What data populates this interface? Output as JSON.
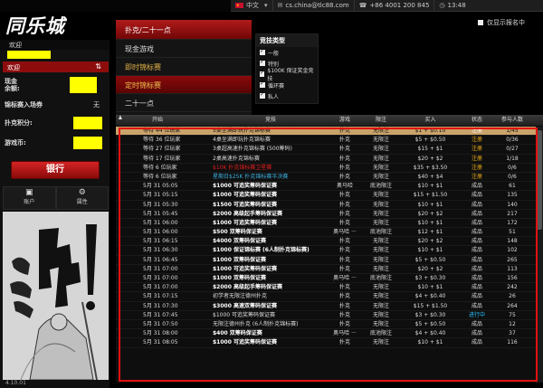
{
  "app": {
    "title": "同乐城"
  },
  "status_bar": {
    "language": "中文",
    "email": "cs.china@tlc88.com",
    "phone": "+86 4001 200 845",
    "time": "13:48"
  },
  "left": {
    "welcome_label": "欢迎",
    "welcome_bar": "欢迎",
    "cash_label": "现金\n余额:",
    "ticket_label": "锦标赛入场券",
    "ticket_value": "无",
    "points_label": "扑克积分:",
    "coins_label": "游戏币:",
    "bank_button": "银行",
    "tile_account": "账户",
    "tile_settings": "属性",
    "version": "4.10.01"
  },
  "menu": {
    "head": "扑克/二十一点",
    "items": [
      "现金游戏",
      "即时锦标赛",
      "定时锦标赛",
      "二十一点"
    ]
  },
  "filter": {
    "title": "竞技类型",
    "options": [
      {
        "label": "一般",
        "checked": true
      },
      {
        "label": "特别",
        "checked": true
      },
      {
        "label": "$100K 保证奖金竞技",
        "checked": true
      },
      {
        "label": "循环赛",
        "checked": true
      },
      {
        "label": "私人",
        "checked": true
      }
    ],
    "only_signup": "仅显示报名中"
  },
  "table": {
    "headers": [
      "",
      "开始",
      "竞技",
      "游戏",
      "限注",
      "买入",
      "状态",
      "参与人数"
    ],
    "rows": [
      {
        "start": "等待 44 位玩家",
        "name": "5桌坐满即玩扑克锦标赛",
        "game": "扑克",
        "limit": "无限注",
        "buyin": "$1 + $0.10",
        "status": "注册",
        "players": "1/45",
        "style": "hl"
      },
      {
        "start": "等待 36 位玩家",
        "name": "4桌坐满即玩扑克锦标赛",
        "game": "扑克",
        "limit": "无限注",
        "buyin": "$5 + $0.50",
        "status": "注册",
        "players": "0/36",
        "style": "signup"
      },
      {
        "start": "等待 27 位玩家",
        "name": "3桌超高速扑克锦标赛 (500筹码)",
        "game": "扑克",
        "limit": "无限注",
        "buyin": "$15 + $1",
        "status": "注册",
        "players": "0/27",
        "style": "signup"
      },
      {
        "start": "等待 17 位玩家",
        "name": "2桌高速扑克锦标赛",
        "game": "扑克",
        "limit": "无限注",
        "buyin": "$20 + $2",
        "status": "注册",
        "players": "1/18",
        "style": "signup"
      },
      {
        "start": "等待 6 位玩家",
        "name": "$10K 扑克锦标赛卫星赛",
        "game": "扑克",
        "limit": "无限注",
        "buyin": "$35 + $3.50",
        "status": "注册",
        "players": "0/6",
        "style": "red"
      },
      {
        "start": "等待 6 位玩家",
        "name": "星期日$25K 扑克锦标赛半决赛",
        "game": "扑克",
        "limit": "无限注",
        "buyin": "$40 + $4",
        "status": "注册",
        "players": "0/6",
        "style": "cyan"
      },
      {
        "start": "5月 31 05:05",
        "name": "$1000 可追奖筹码保证赛",
        "game": "奥马哈",
        "limit": "底池限注",
        "buyin": "$10 + $1",
        "status": "成品",
        "players": "61",
        "style": "bold"
      },
      {
        "start": "5月 31 05:15",
        "name": "$1000 可追奖筹码保证赛",
        "game": "扑克",
        "limit": "无限注",
        "buyin": "$15 + $1.50",
        "status": "成品",
        "players": "135",
        "style": "bold"
      },
      {
        "start": "5月 31 05:30",
        "name": "$1500 可追奖筹码保证赛",
        "game": "扑克",
        "limit": "无限注",
        "buyin": "$10 + $1",
        "status": "成品",
        "players": "140",
        "style": "bold"
      },
      {
        "start": "5月 31 05:45",
        "name": "$2000 高级起手筹码保证赛",
        "game": "扑克",
        "limit": "无限注",
        "buyin": "$20 + $2",
        "status": "成品",
        "players": "217",
        "style": "bold"
      },
      {
        "start": "5月 31 06:00",
        "name": "$1000 可追奖筹码保证赛",
        "game": "扑克",
        "limit": "无限注",
        "buyin": "$10 + $1",
        "status": "成品",
        "players": "172",
        "style": "bold"
      },
      {
        "start": "5月 31 06:00",
        "name": "$500 双筹码保证赛",
        "game": "奥马哈 ···",
        "limit": "底池限注",
        "buyin": "$12 + $1",
        "status": "成品",
        "players": "51",
        "style": "bold"
      },
      {
        "start": "5月 31 06:15",
        "name": "$4000 双筹码保证赛",
        "game": "扑克",
        "limit": "无限注",
        "buyin": "$20 + $2",
        "status": "成品",
        "players": "148",
        "style": "bold"
      },
      {
        "start": "5月 31 06:30",
        "name": "$1000 保证锦标赛 (6人制扑克锦标赛)",
        "game": "扑克",
        "limit": "无限注",
        "buyin": "$10 + $1",
        "status": "成品",
        "players": "102",
        "style": "bold"
      },
      {
        "start": "5月 31 06:45",
        "name": "$1000 双筹码保证赛",
        "game": "扑克",
        "limit": "无限注",
        "buyin": "$5 + $0.50",
        "status": "成品",
        "players": "265",
        "style": "bold"
      },
      {
        "start": "5月 31 07:00",
        "name": "$1000 可追奖筹码保证赛",
        "game": "扑克",
        "limit": "无限注",
        "buyin": "$20 + $2",
        "status": "成品",
        "players": "113",
        "style": "bold"
      },
      {
        "start": "5月 31 07:00",
        "name": "$1000 双筹码保证赛",
        "game": "奥马哈 ···",
        "limit": "底池限注",
        "buyin": "$3 + $0.30",
        "status": "成品",
        "players": "156",
        "style": "bold"
      },
      {
        "start": "5月 31 07:00",
        "name": "$2000 高级起手筹码保证赛",
        "game": "扑克",
        "limit": "无限注",
        "buyin": "$10 + $1",
        "status": "成品",
        "players": "242",
        "style": "bold"
      },
      {
        "start": "5月 31 07:15",
        "name": "初学者无限注德州扑克",
        "game": "扑克",
        "limit": "无限注",
        "buyin": "$4 + $0.40",
        "status": "成品",
        "players": "26",
        "style": "plain"
      },
      {
        "start": "5月 31 07:30",
        "name": "$3000 高速双筹码保证赛",
        "game": "扑克",
        "limit": "无限注",
        "buyin": "$15 + $1.50",
        "status": "成品",
        "players": "264",
        "style": "bold"
      },
      {
        "start": "5月 31 07:45",
        "name": "$1000 可追奖筹码保证赛",
        "game": "扑克",
        "limit": "无限注",
        "buyin": "$3 + $0.30",
        "status": "进行中",
        "players": "75",
        "style": "running"
      },
      {
        "start": "5月 31 07:50",
        "name": "无限注德州扑克 (6人制扑克锦标赛)",
        "game": "扑克",
        "limit": "无限注",
        "buyin": "$5 + $0.50",
        "status": "成品",
        "players": "12",
        "style": "plain"
      },
      {
        "start": "5月 31 08:00",
        "name": "$400 双筹码保证赛",
        "game": "奥马哈 ···",
        "limit": "底池限注",
        "buyin": "$4 + $0.40",
        "status": "成品",
        "players": "37",
        "style": "bold"
      },
      {
        "start": "5月 31 08:05",
        "name": "$1000 可追奖筹码保证赛",
        "game": "扑克",
        "limit": "无限注",
        "buyin": "$10 + $1",
        "status": "成品",
        "players": "116",
        "style": "bold"
      }
    ]
  },
  "colors": {
    "accent_red": "#c41414",
    "highlight": "#caa36a",
    "signup": "#f2b21a",
    "running": "#2ac2ff",
    "username_bar": "#ffff00"
  }
}
